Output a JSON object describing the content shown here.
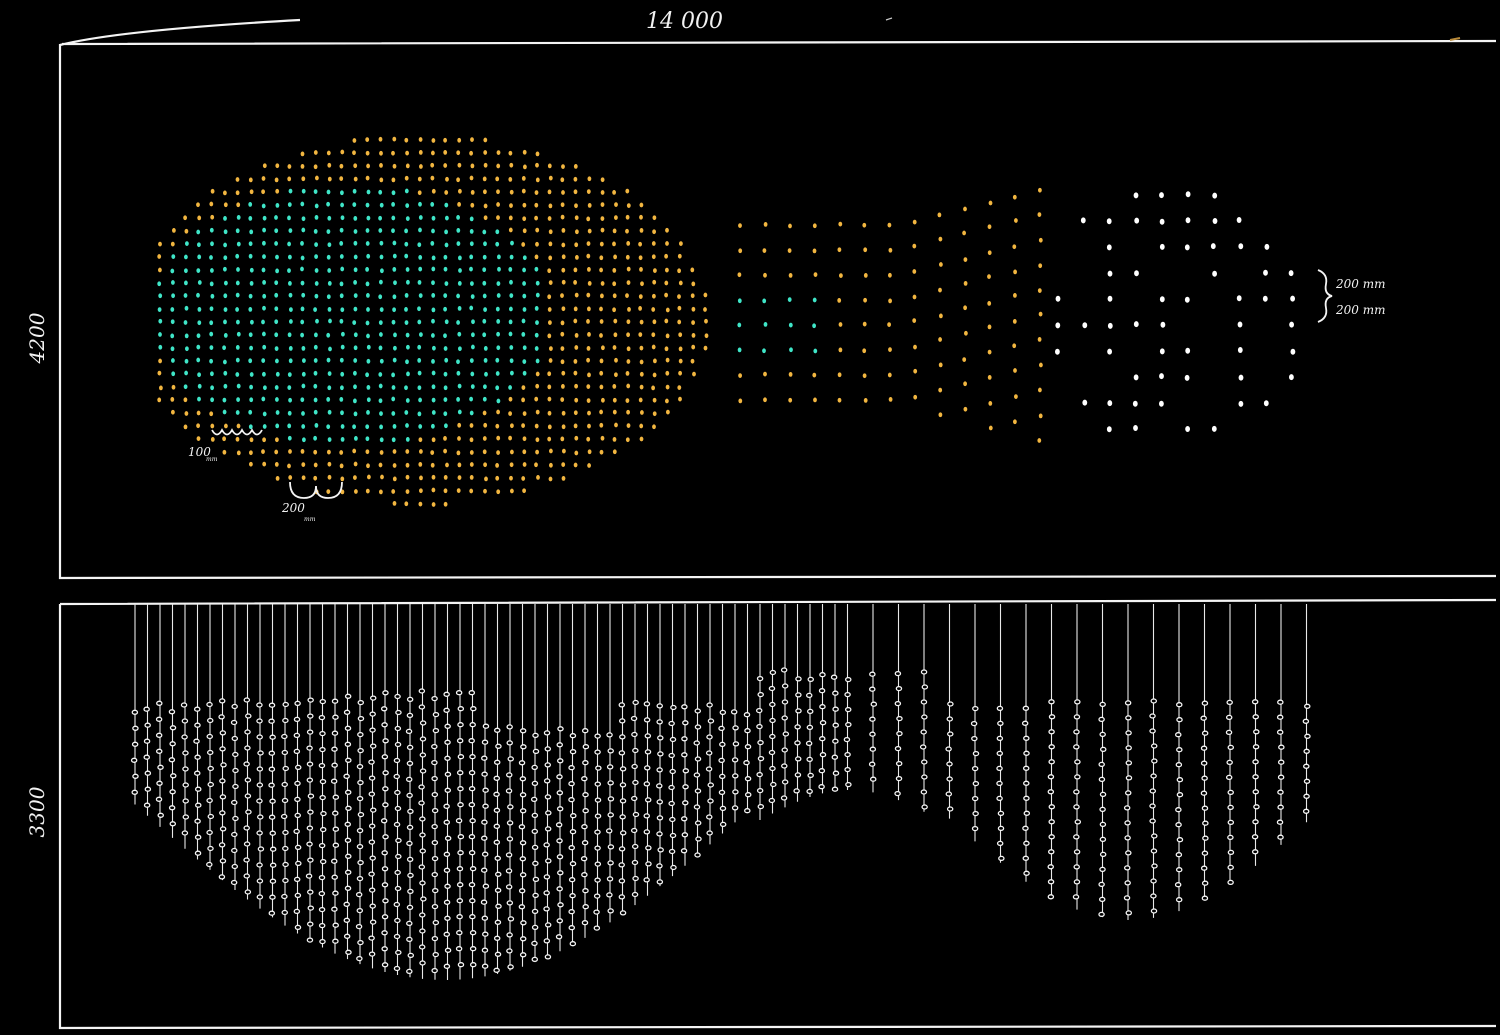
{
  "dimensions": {
    "width_label": "14 000",
    "height_plan_label": "4200",
    "height_elevation_label": "3300"
  },
  "annotations": {
    "spacing_small": "100",
    "spacing_small_unit": "mm",
    "spacing_medium": "200",
    "spacing_medium_unit": "mm",
    "spacing_right_1": "200 mm",
    "spacing_right_2": "200 mm"
  },
  "colors": {
    "background": "#000000",
    "line": "#f4f4f4",
    "cyan_dots": "#3fe6c8",
    "amber_dots": "#f2b640",
    "white_dots": "#ffffff"
  }
}
